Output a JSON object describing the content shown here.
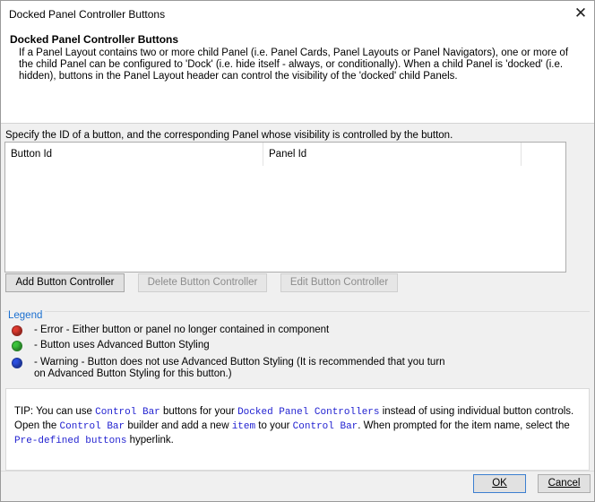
{
  "window": {
    "title": "Docked Panel Controller Buttons",
    "close_glyph": "✕"
  },
  "header": {
    "title": "Docked Panel Controller Buttons",
    "description": "If a Panel Layout contains two or more child Panel (i.e. Panel Cards, Panel Layouts or Panel Navigators), one or more of the child Panel can be configured to 'Dock' (i.e. hide itself - always, or conditionally). When a child Panel is 'docked' (i.e. hidden), buttons in the Panel Layout header can control the visibility of the 'docked' child Panels."
  },
  "main": {
    "instruction": "Specify the ID of a button, and the corresponding Panel whose visibility is controlled by the button.",
    "table": {
      "columns": [
        "Button Id",
        "Panel Id"
      ],
      "rows": []
    },
    "buttons": {
      "add": "Add Button Controller",
      "delete": "Delete Button Controller",
      "edit": "Edit Button Controller"
    }
  },
  "legend": {
    "label": "Legend",
    "items": [
      {
        "color": "#e03a2f",
        "text": "- Error - Either button or panel no longer contained in component"
      },
      {
        "color": "#3cc43c",
        "text": "- Button uses Advanced Button Styling"
      },
      {
        "color": "#2b4fe0",
        "text": "- Warning - Button does not use Advanced Button Styling (It is recommended that you turn on Advanced Button Styling for this button.)"
      }
    ]
  },
  "tip": {
    "p1": "TIP: You can use ",
    "code1": "Control Bar",
    "p2": " buttons for your ",
    "code2": "Docked Panel Controllers",
    "p3": " instead of using individual button controls. Open the ",
    "code3": "Control Bar",
    "p4": " builder and add a new ",
    "code4": "item",
    "p5": " to your ",
    "code5": "Control Bar",
    "p6": ". When prompted for the item name, select the ",
    "code6": "Pre-defined buttons",
    "p7": " hyperlink."
  },
  "footer": {
    "ok": "OK",
    "cancel": "Cancel"
  }
}
